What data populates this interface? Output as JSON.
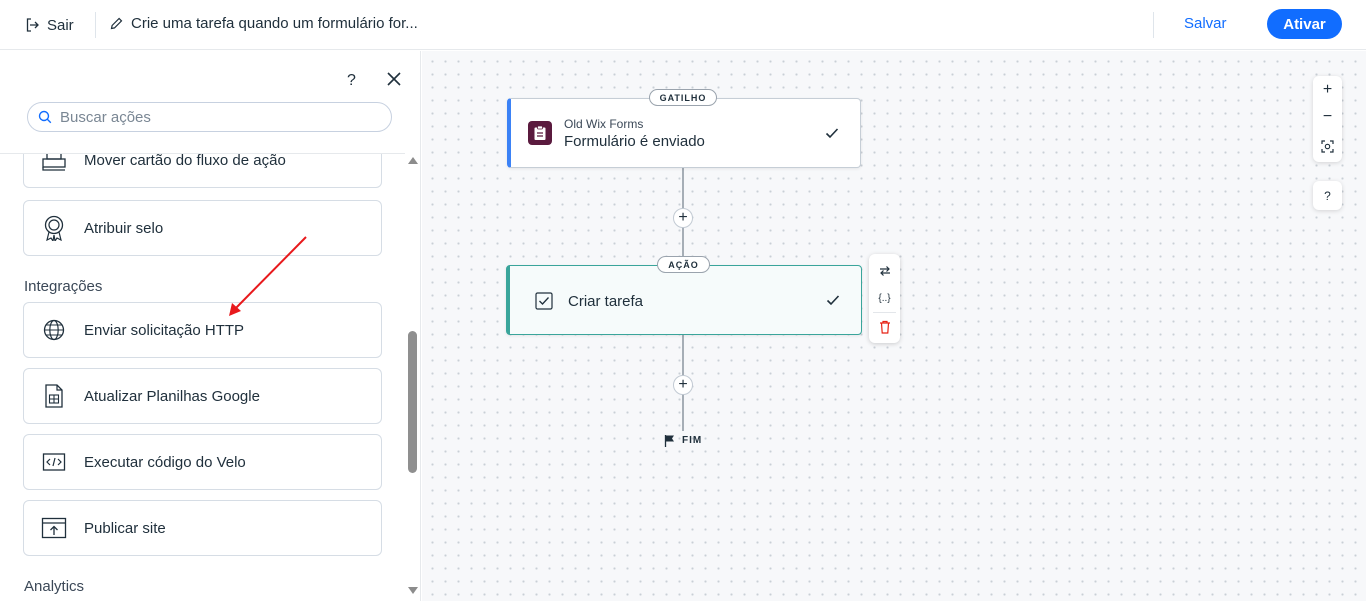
{
  "header": {
    "exit_label": "Sair",
    "automation_title": "Crie uma tarefa quando um formulário for...",
    "save_label": "Salvar",
    "activate_label": "Ativar"
  },
  "sidebar": {
    "help_label": "?",
    "search_placeholder": "Buscar ações",
    "items_top": [
      {
        "label": "Mover cartão do fluxo de ação",
        "icon": "move-card-icon"
      },
      {
        "label": "Atribuir selo",
        "icon": "badge-icon"
      }
    ],
    "section_integrations": "Integrações",
    "integrations": [
      {
        "label": "Enviar solicitação HTTP",
        "icon": "globe-icon"
      },
      {
        "label": "Atualizar Planilhas Google",
        "icon": "spreadsheet-icon"
      },
      {
        "label": "Executar código do Velo",
        "icon": "code-icon"
      },
      {
        "label": "Publicar site",
        "icon": "publish-site-icon"
      }
    ],
    "section_analytics": "Analytics"
  },
  "flow": {
    "trigger": {
      "tag": "GATILHO",
      "app": "Old Wix Forms",
      "event": "Formulário é enviado"
    },
    "action": {
      "tag": "AÇÃO",
      "label": "Criar tarefa"
    },
    "end_label": "FIM"
  },
  "zoom": {
    "zoom_in": "+",
    "zoom_out": "−",
    "help": "?"
  },
  "colors": {
    "primary": "#116dff",
    "trigger_accent": "#3b82f6",
    "action_accent": "#3aa59b",
    "delete": "#e62214",
    "arrow_annotation": "#e8191c"
  }
}
